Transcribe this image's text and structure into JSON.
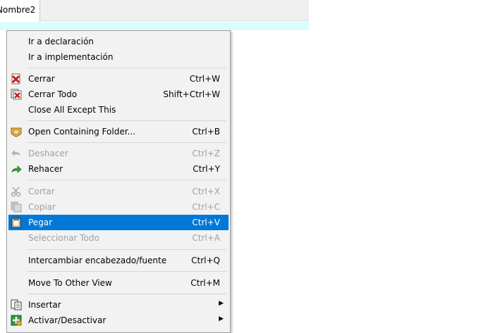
{
  "tab": {
    "label": "Nombre2"
  },
  "menu": {
    "items": [
      {
        "id": "ir-declaracion",
        "label": "Ir a declaración",
        "shortcut": "",
        "icon": "",
        "disabled": false
      },
      {
        "id": "ir-implementacion",
        "label": "Ir a implementación",
        "shortcut": "",
        "icon": "",
        "disabled": false
      },
      {
        "id": "cerrar",
        "label": "Cerrar",
        "shortcut": "Ctrl+W",
        "icon": "close-doc-icon",
        "disabled": false
      },
      {
        "id": "cerrar-todo",
        "label": "Cerrar Todo",
        "shortcut": "Shift+Ctrl+W",
        "icon": "close-all-icon",
        "disabled": false
      },
      {
        "id": "close-all-except",
        "label": "Close All Except This",
        "shortcut": "",
        "icon": "",
        "disabled": false
      },
      {
        "id": "open-containing-folder",
        "label": "Open Containing Folder...",
        "shortcut": "Ctrl+B",
        "icon": "folder-icon",
        "disabled": false
      },
      {
        "id": "deshacer",
        "label": "Deshacer",
        "shortcut": "Ctrl+Z",
        "icon": "undo-icon",
        "disabled": true
      },
      {
        "id": "rehacer",
        "label": "Rehacer",
        "shortcut": "Ctrl+Y",
        "icon": "redo-icon",
        "disabled": false
      },
      {
        "id": "cortar",
        "label": "Cortar",
        "shortcut": "Ctrl+X",
        "icon": "cut-icon",
        "disabled": true
      },
      {
        "id": "copiar",
        "label": "Copiar",
        "shortcut": "Ctrl+C",
        "icon": "copy-icon",
        "disabled": true
      },
      {
        "id": "pegar",
        "label": "Pegar",
        "shortcut": "Ctrl+V",
        "icon": "paste-icon",
        "disabled": false,
        "selected": true
      },
      {
        "id": "seleccionar-todo",
        "label": "Seleccionar Todo",
        "shortcut": "Ctrl+A",
        "icon": "",
        "disabled": true
      },
      {
        "id": "intercambiar",
        "label": "Intercambiar encabezado/fuente",
        "shortcut": "Ctrl+Q",
        "icon": "",
        "disabled": false
      },
      {
        "id": "move-other-view",
        "label": "Move To Other View",
        "shortcut": "Ctrl+M",
        "icon": "",
        "disabled": false
      },
      {
        "id": "insertar",
        "label": "Insertar",
        "shortcut": "",
        "icon": "insert-icon",
        "disabled": false,
        "submenu": true
      },
      {
        "id": "activar-desactivar",
        "label": "Activar/Desactivar",
        "shortcut": "",
        "icon": "toggle-icon",
        "disabled": false,
        "submenu": true
      }
    ]
  },
  "colors": {
    "selection": "#0078d7",
    "menu_background": "#f2f2f2",
    "editor_band": "#ddfcfc"
  }
}
